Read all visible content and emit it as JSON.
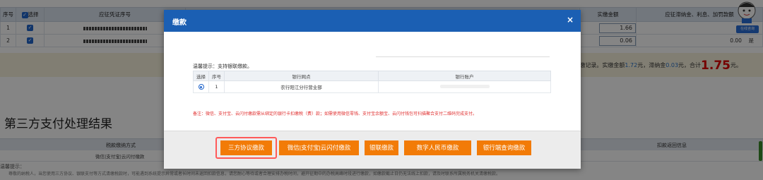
{
  "bg": {
    "headers": [
      "序号",
      "选择",
      "应征凭证序号",
      "实缴金额",
      "应征滞纳金、利息、加罚款额"
    ],
    "rows": [
      {
        "no": "1",
        "amount": "1.66",
        "penalty": "0"
      },
      {
        "no": "2",
        "amount": "0.06",
        "penalty": "0.00",
        "suffix": "是"
      }
    ],
    "summary": {
      "p1": "共2条待清缴记录。实缴金额",
      "amount": "1.72",
      "p2": "元，滞纳金",
      "late": "0.03",
      "p3": "元，合计",
      "total": "1.75",
      "p4": "元。"
    },
    "section_title": "第三方支付处理结果",
    "result_headers": [
      "税款缴纳方式",
      "扣款返回信息"
    ],
    "result_row": "微信|支付宝|云闪付缴款",
    "tips_label": "温馨提示：",
    "tips_body": "尊敬的纳税人，当您使用三方协议、银联支付等方式清缴税款时，可能遇到系统提示异常或者长时间未返回扣款信息，请您耐心等待或者合理安排办税时间，避开征期中的办税高峰时段进行缴款，如缴款截止日仍无法线上扣款，请及时联系所属税务机关清缴税款。",
    "mascot_button": "在线咨询"
  },
  "modal": {
    "title": "缴款",
    "close": "×",
    "hint": "温馨提示：支持银联缴款。",
    "table_headers": [
      "选择",
      "序号",
      "银行网点",
      "银行账户"
    ],
    "table_row": {
      "no": "1",
      "branch": "农行阳江分行营业部"
    },
    "note": "备注：微信、支付宝、云闪付缴款需从绑定的银行卡扣缴税（费）款；如需使用微信零钱、支付宝余额宝、云闪付钱包可扫描聚合支付二维码完成支付。",
    "buttons": [
      "三方协议缴款",
      "微信|支付宝|云闪付缴款",
      "银联缴款",
      "数字人民币缴款",
      "银行端查询缴款"
    ]
  },
  "colors": {
    "primary": "#1b5fb3",
    "button": "#f27b07",
    "highlight": "#ff5a5a",
    "total": "#e00000"
  }
}
